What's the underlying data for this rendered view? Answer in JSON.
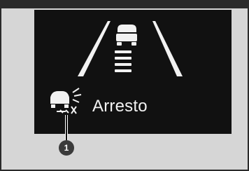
{
  "display": {
    "status_label": "Arresto",
    "icons": {
      "road": "road-lanes-icon",
      "lead_vehicle": "lead-vehicle-icon",
      "status": "acc-car-status-icon"
    },
    "colors": {
      "screen": "#111111",
      "foreground": "#f2f2f2",
      "page": "#d6d6d6"
    }
  },
  "callout": {
    "number": "1"
  }
}
